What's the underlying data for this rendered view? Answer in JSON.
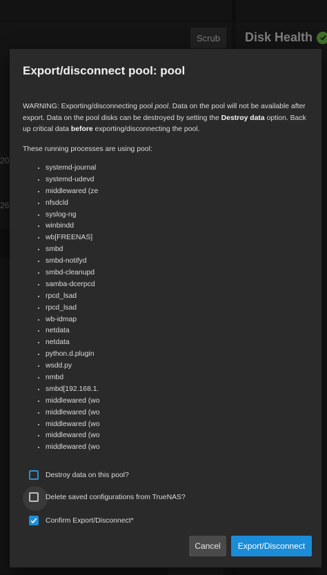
{
  "background": {
    "scrub_label": "Scrub",
    "disk_health_label": "Disk Health",
    "side_numbers": [
      "20",
      "26"
    ]
  },
  "dialog": {
    "title": "Export/disconnect pool: pool",
    "warning": {
      "prefix": "WARNING: Exporting/disconnecting pool ",
      "pool_name": "pool",
      "mid": ". Data on the pool will not be available after export. Data on the pool disks can be destroyed by setting the ",
      "destroy_label": "Destroy data",
      "mid2": " option. Back up critical data ",
      "before_label": "before",
      "suffix": " exporting/disconnecting the pool."
    },
    "processes_intro": "These running processes are using pool:",
    "processes": [
      "systemd-journal",
      "systemd-udevd",
      "middlewared (ze",
      "nfsdcld",
      "syslog-ng",
      "winbindd",
      "wb[FREENAS]",
      "smbd",
      "smbd-notifyd",
      "smbd-cleanupd",
      "samba-dcerpcd",
      "rpcd_lsad",
      "rpcd_lsad",
      "wb-idmap",
      "netdata",
      "netdata",
      "python.d.plugin",
      "wsdd.py",
      "nmbd",
      "smbd[192.168.1.",
      "middlewared (wo",
      "middlewared (wo",
      "middlewared (wo",
      "middlewared (wo",
      "middlewared (wo"
    ],
    "checkboxes": {
      "destroy": {
        "label": "Destroy data on this pool?",
        "checked": false
      },
      "delete_config": {
        "label": "Delete saved configurations from TrueNAS?",
        "checked": false
      },
      "confirm": {
        "label": "Confirm Export/Disconnect*",
        "checked": true
      }
    },
    "buttons": {
      "cancel": "Cancel",
      "export": "Export/Disconnect"
    }
  },
  "colors": {
    "accent": "#1a8cd8",
    "health_ok": "#71bf44",
    "dialog_bg": "#2a2a2a"
  }
}
